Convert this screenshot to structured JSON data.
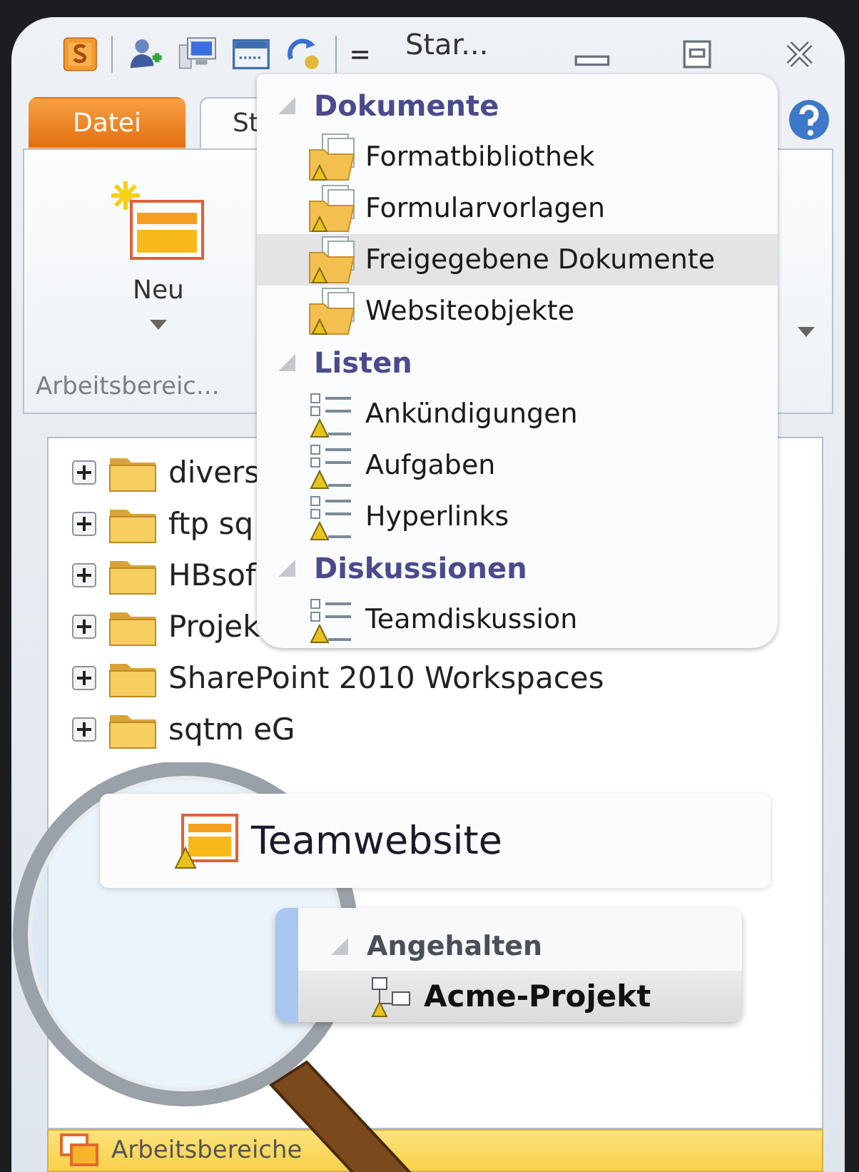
{
  "window": {
    "title": "Star..."
  },
  "tabs": [
    {
      "label": "Datei",
      "kind": "file",
      "selected": false
    },
    {
      "label": "St",
      "kind": "tab",
      "selected": true
    }
  ],
  "ribbon": {
    "button": {
      "label": "Neu"
    },
    "group_label": "Arbeitsbereic..."
  },
  "tree": {
    "items": [
      {
        "label": "divers",
        "expanded": false
      },
      {
        "label": "ftp sq",
        "expanded": false
      },
      {
        "label": "HBsof",
        "expanded": false
      },
      {
        "label": "Projek",
        "expanded": false
      },
      {
        "label": "SharePoint 2010 Workspaces",
        "expanded": false
      },
      {
        "label": "sqtm eG",
        "expanded": false
      }
    ]
  },
  "popup": {
    "sections": [
      {
        "title": "Dokumente",
        "kind": "library",
        "expanded": true,
        "items": [
          {
            "label": "Formatbibliothek",
            "selected": false
          },
          {
            "label": "Formularvorlagen",
            "selected": false
          },
          {
            "label": "Freigegebene Dokumente",
            "selected": true
          },
          {
            "label": "Websiteobjekte",
            "selected": false
          }
        ]
      },
      {
        "title": "Listen",
        "kind": "list",
        "expanded": true,
        "items": [
          {
            "label": "Ankündigungen",
            "selected": false
          },
          {
            "label": "Aufgaben",
            "selected": false
          },
          {
            "label": "Hyperlinks",
            "selected": false
          }
        ]
      },
      {
        "title": "Diskussionen",
        "kind": "list",
        "expanded": true,
        "items": [
          {
            "label": "Teamdiskussion",
            "selected": false
          }
        ]
      }
    ]
  },
  "magnified_item": {
    "label": "Teamwebsite"
  },
  "callout": {
    "section": {
      "title": "Angehalten",
      "expanded": true
    },
    "item": {
      "label": "Acme-Projekt",
      "selected": true
    }
  },
  "bottom_bar": {
    "label": "Arbeitsbereiche"
  }
}
